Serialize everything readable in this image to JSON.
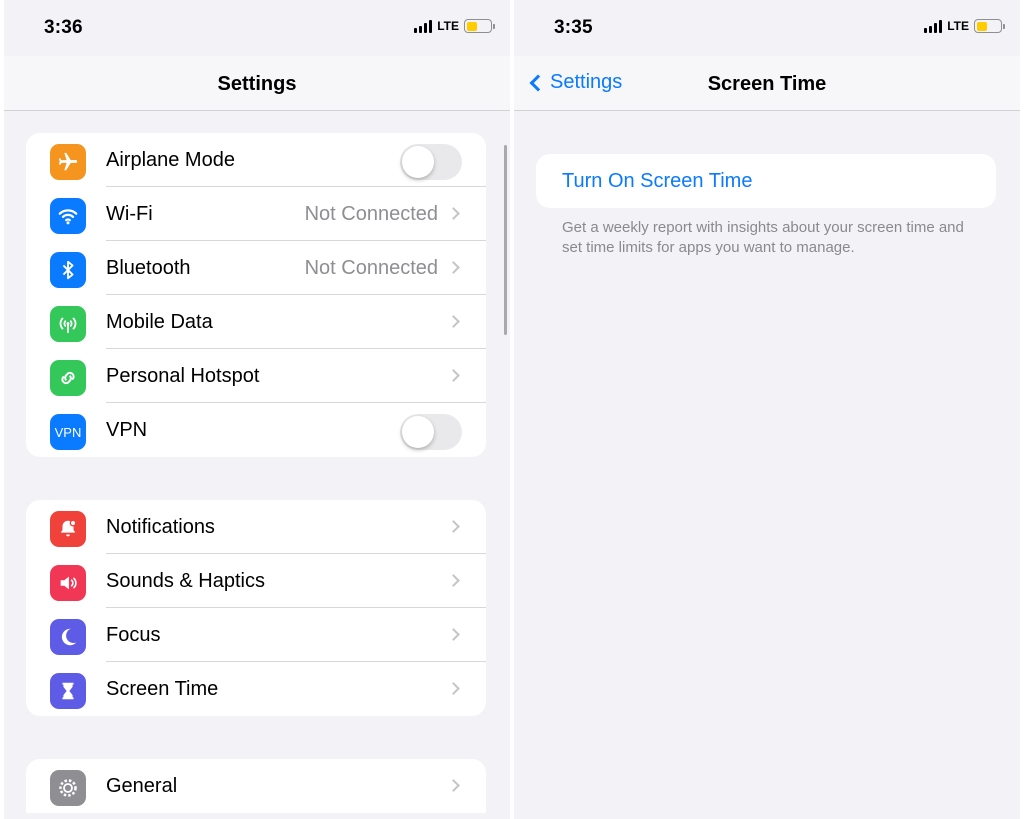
{
  "left": {
    "status": {
      "time": "3:36",
      "network": "LTE"
    },
    "nav_title": "Settings",
    "group1": [
      {
        "label": "Airplane Mode",
        "icon": "airplane-icon",
        "color": "#f5951f",
        "type": "toggle"
      },
      {
        "label": "Wi-Fi",
        "icon": "wifi-icon",
        "color": "#0a7aff",
        "value": "Not Connected",
        "type": "chevron"
      },
      {
        "label": "Bluetooth",
        "icon": "bluetooth-icon",
        "color": "#0a7aff",
        "value": "Not Connected",
        "type": "chevron"
      },
      {
        "label": "Mobile Data",
        "icon": "antenna-icon",
        "color": "#34c759",
        "type": "chevron"
      },
      {
        "label": "Personal Hotspot",
        "icon": "hotspot-icon",
        "color": "#34c759",
        "type": "chevron"
      },
      {
        "label": "VPN",
        "icon": "vpn-icon",
        "icon_text": "VPN",
        "color": "#0a7aff",
        "type": "toggle"
      }
    ],
    "group2": [
      {
        "label": "Notifications",
        "icon": "bell-icon",
        "color": "#f0413b",
        "type": "chevron"
      },
      {
        "label": "Sounds & Haptics",
        "icon": "speaker-icon",
        "color": "#f23756",
        "type": "chevron"
      },
      {
        "label": "Focus",
        "icon": "moon-icon",
        "color": "#5e5ce6",
        "type": "chevron"
      },
      {
        "label": "Screen Time",
        "icon": "hourglass-icon",
        "color": "#5e5ce6",
        "type": "chevron"
      }
    ],
    "group3": [
      {
        "label": "General",
        "icon": "gear-icon",
        "color": "#8e8e93",
        "type": "chevron"
      }
    ]
  },
  "right": {
    "status": {
      "time": "3:35",
      "network": "LTE"
    },
    "back_label": "Settings",
    "nav_title": "Screen Time",
    "turn_on_label": "Turn On Screen Time",
    "description": "Get a weekly report with insights about your screen time and set time limits for apps you want to manage."
  }
}
